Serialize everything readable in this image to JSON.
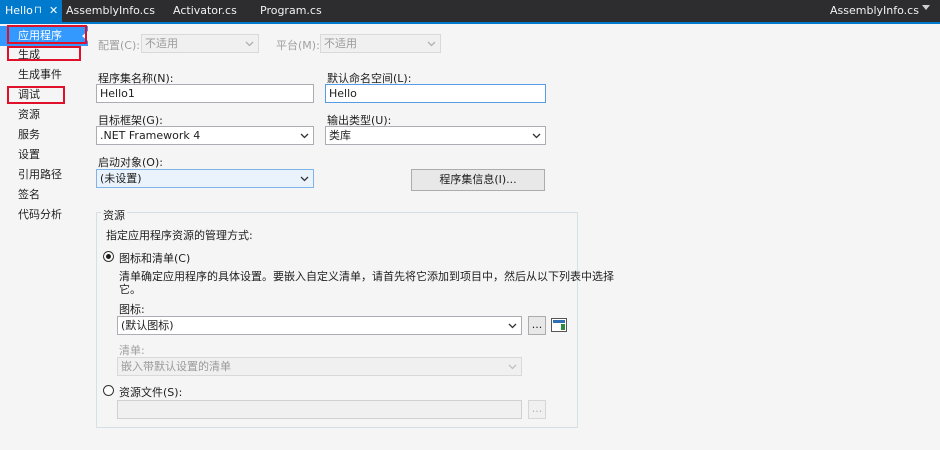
{
  "tabs": {
    "active": {
      "label": "Hello"
    },
    "items": [
      {
        "label": "AssemblyInfo.cs"
      },
      {
        "label": "Activator.cs"
      },
      {
        "label": "Program.cs"
      }
    ],
    "right_label": "AssemblyInfo.cs"
  },
  "sidebar": {
    "items": [
      {
        "label": "应用程序",
        "selected": true
      },
      {
        "label": "生成"
      },
      {
        "label": "生成事件"
      },
      {
        "label": "调试"
      },
      {
        "label": "资源"
      },
      {
        "label": "服务"
      },
      {
        "label": "设置"
      },
      {
        "label": "引用路径"
      },
      {
        "label": "签名"
      },
      {
        "label": "代码分析"
      }
    ]
  },
  "config": {
    "config_label": "配置(C):",
    "config_value": "不适用",
    "platform_label": "平台(M):",
    "platform_value": "不适用"
  },
  "app": {
    "assembly_name_label": "程序集名称(N):",
    "assembly_name_value": "Hello1",
    "default_namespace_label": "默认命名空间(L):",
    "default_namespace_value": "Hello",
    "target_framework_label": "目标框架(G):",
    "target_framework_value": ".NET Framework 4",
    "output_type_label": "输出类型(U):",
    "output_type_value": "类库",
    "startup_object_label": "启动对象(O):",
    "startup_object_value": "(未设置)",
    "assembly_info_button": "程序集信息(I)..."
  },
  "resources": {
    "group_label": "资源",
    "instruction": "指定应用程序资源的管理方式:",
    "icon_manifest_radio": "图标和清单(C)",
    "icon_manifest_desc_line1": "清单确定应用程序的具体设置。要嵌入自定义清单，请首先将它添加到项目中，然后从以下列表中选择",
    "icon_manifest_desc_line2": "它。",
    "icon_label": "图标:",
    "icon_value": "(默认图标)",
    "browse_label": "...",
    "manifest_label": "清单:",
    "manifest_value": "嵌入带默认设置的清单",
    "resource_file_radio": "资源文件(S):",
    "resource_file_value": ""
  },
  "colors": {
    "accent": "#007acc",
    "selection": "#3399ff",
    "highlight_box": "#e0102a"
  }
}
